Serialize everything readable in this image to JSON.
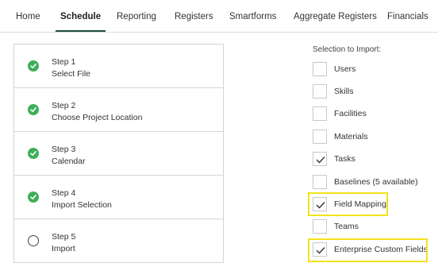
{
  "nav": {
    "tabs": [
      {
        "label": "Home",
        "active": false
      },
      {
        "label": "Schedule",
        "active": true
      },
      {
        "label": "Reporting",
        "active": false
      },
      {
        "label": "Registers",
        "active": false
      },
      {
        "label": "Smartforms",
        "active": false
      },
      {
        "label": "Aggregate Registers",
        "active": false
      },
      {
        "label": "Financials",
        "active": false
      }
    ]
  },
  "steps": [
    {
      "title": "Step 1",
      "subtitle": "Select File",
      "status": "complete"
    },
    {
      "title": "Step 2",
      "subtitle": "Choose Project Location",
      "status": "complete"
    },
    {
      "title": "Step 3",
      "subtitle": "Calendar",
      "status": "complete"
    },
    {
      "title": "Step 4",
      "subtitle": "Import Selection",
      "status": "complete"
    },
    {
      "title": "Step 5",
      "subtitle": "Import",
      "status": "pending"
    }
  ],
  "selection": {
    "heading": "Selection to Import:",
    "options": [
      {
        "label": "Users",
        "checked": false,
        "highlighted": false
      },
      {
        "label": "Skills",
        "checked": false,
        "highlighted": false
      },
      {
        "label": "Facilities",
        "checked": false,
        "highlighted": false
      },
      {
        "label": "Materials",
        "checked": false,
        "highlighted": false
      },
      {
        "label": "Tasks",
        "checked": true,
        "highlighted": false
      },
      {
        "label": "Baselines (5 available)",
        "checked": false,
        "highlighted": false
      },
      {
        "label": "Field Mapping",
        "checked": true,
        "highlighted": true
      },
      {
        "label": "Teams",
        "checked": false,
        "highlighted": false
      },
      {
        "label": "Enterprise Custom Fields",
        "checked": true,
        "highlighted": true
      }
    ]
  },
  "colors": {
    "complete": "#3fae5a",
    "active_underline": "#1f4e3d",
    "highlight": "#f2e21e"
  },
  "icons": {
    "complete": "check-circle-icon",
    "pending": "empty-circle-icon",
    "checked": "checkmark-icon"
  }
}
